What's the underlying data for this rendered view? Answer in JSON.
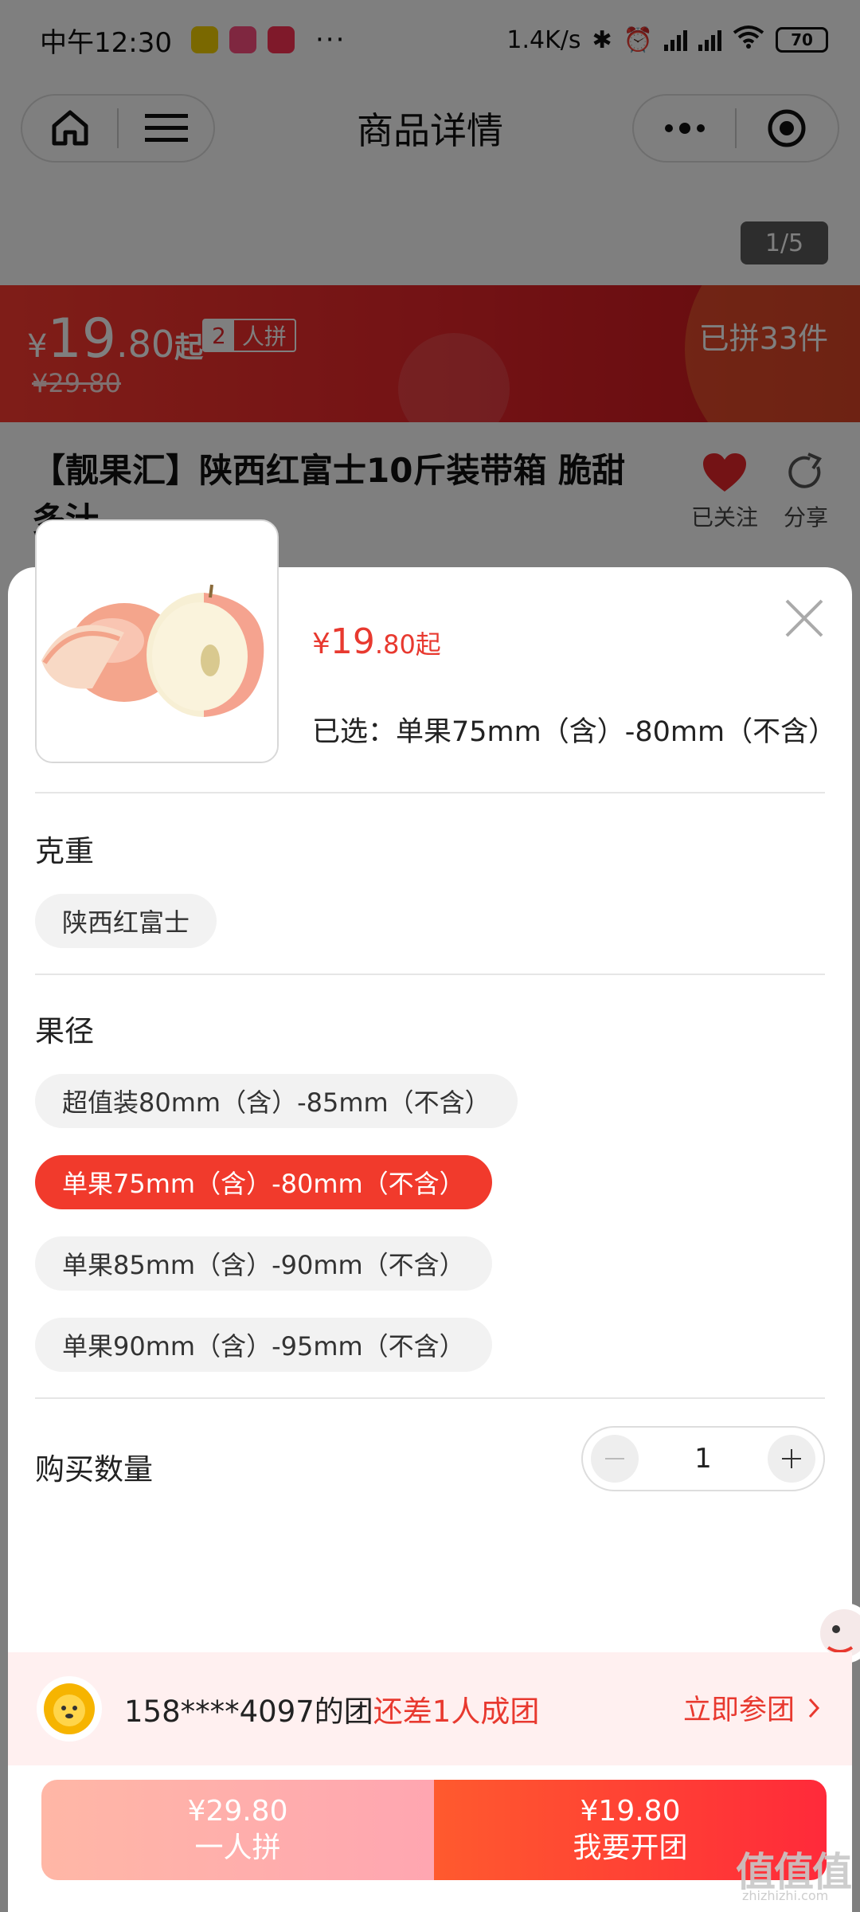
{
  "status_bar": {
    "time": "中午12:30",
    "more": "···",
    "net_speed": "1.4K/s",
    "battery": "70"
  },
  "nav": {
    "title": "商品详情"
  },
  "gallery": {
    "pager": "1/5"
  },
  "price_banner": {
    "currency": "¥",
    "price_int": "19",
    "price_dec": ".80",
    "suffix": "起",
    "group_size": "2",
    "group_word": "人拼",
    "original_price": "¥29.80",
    "joined": "已拼33件"
  },
  "product": {
    "title": "【靓果汇】陕西红富士10斤装带箱 脆甜多汁",
    "follow_label": "已关注",
    "share_label": "分享"
  },
  "sheet": {
    "price_currency": "¥",
    "price_int": "19",
    "price_dec": ".80",
    "price_suffix": "起",
    "selected": "已选：单果75mm（含）-80mm（不含）",
    "weight_label": "克重",
    "weight_options": [
      "陕西红富士"
    ],
    "diameter_label": "果径",
    "diameter_options": [
      "超值装80mm（含）-85mm（不含）",
      "单果75mm（含）-80mm（不含）",
      "单果85mm（含）-90mm（不含）",
      "单果90mm（含）-95mm（不含）"
    ],
    "selected_diameter_index": 1,
    "quantity_label": "购买数量",
    "quantity": "1"
  },
  "group_bar": {
    "user_text": "158****4097的团",
    "need_text": "还差1人成团",
    "join_label": "立即参团"
  },
  "bottom": {
    "single_price": "¥29.80",
    "single_label": "一人拼",
    "group_price": "¥19.80",
    "group_label": "我要开团"
  },
  "watermark": {
    "text": "值值值",
    "sub": "zhizhizhi.com"
  },
  "colors": {
    "accent": "#e8392f",
    "banner": "#e8262a",
    "chip_active": "#f13a2c"
  }
}
